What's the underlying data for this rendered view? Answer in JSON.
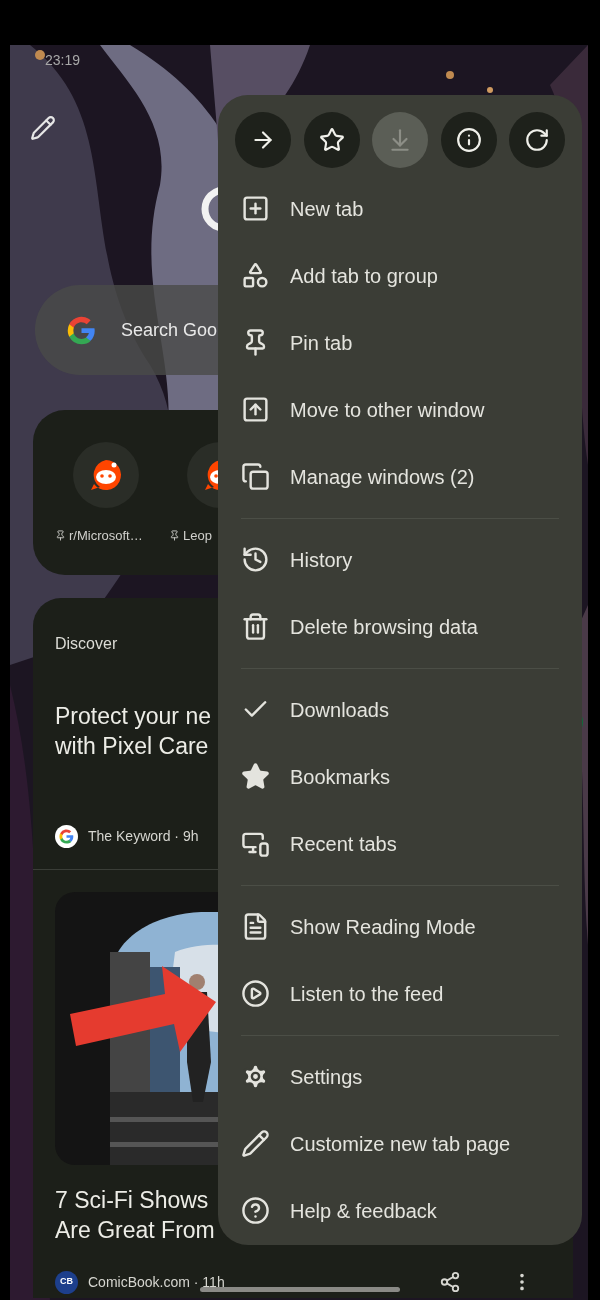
{
  "status_bar": {
    "time": "23:19"
  },
  "search": {
    "placeholder": "Search Goo"
  },
  "shortcuts": [
    {
      "label": "r/Microsoft…"
    },
    {
      "label": "Leop"
    }
  ],
  "discover": {
    "title": "Discover",
    "articles": [
      {
        "title_lines": [
          "Protect your ne",
          "with Pixel Care"
        ],
        "source": "The Keyword · 9h",
        "has_image": false
      },
      {
        "title_lines": [
          "7 Sci-Fi Shows",
          "Are Great From"
        ],
        "source": "ComicBook.com · 11h",
        "logo_text": "CB",
        "has_image": true
      }
    ]
  },
  "menu": {
    "top_actions": [
      {
        "kind": "forward",
        "disabled": false
      },
      {
        "kind": "bookmark",
        "disabled": false
      },
      {
        "kind": "download",
        "disabled": true
      },
      {
        "kind": "info",
        "disabled": false
      },
      {
        "kind": "reload",
        "disabled": false
      }
    ],
    "groups": [
      [
        {
          "kind": "new-tab",
          "label": "New tab"
        },
        {
          "kind": "group",
          "label": "Add tab to group"
        },
        {
          "kind": "pin",
          "label": "Pin tab"
        },
        {
          "kind": "move",
          "label": "Move to other window"
        },
        {
          "kind": "windows",
          "label": "Manage windows (2)"
        }
      ],
      [
        {
          "kind": "history",
          "label": "History"
        },
        {
          "kind": "delete",
          "label": "Delete browsing data"
        }
      ],
      [
        {
          "kind": "downloads",
          "label": "Downloads"
        },
        {
          "kind": "bookmarks",
          "label": "Bookmarks"
        },
        {
          "kind": "recent",
          "label": "Recent tabs"
        }
      ],
      [
        {
          "kind": "reading",
          "label": "Show Reading Mode"
        },
        {
          "kind": "listen",
          "label": "Listen to the feed"
        }
      ],
      [
        {
          "kind": "settings",
          "label": "Settings"
        },
        {
          "kind": "customize",
          "label": "Customize new tab page"
        },
        {
          "kind": "help",
          "label": "Help & feedback"
        }
      ]
    ]
  }
}
